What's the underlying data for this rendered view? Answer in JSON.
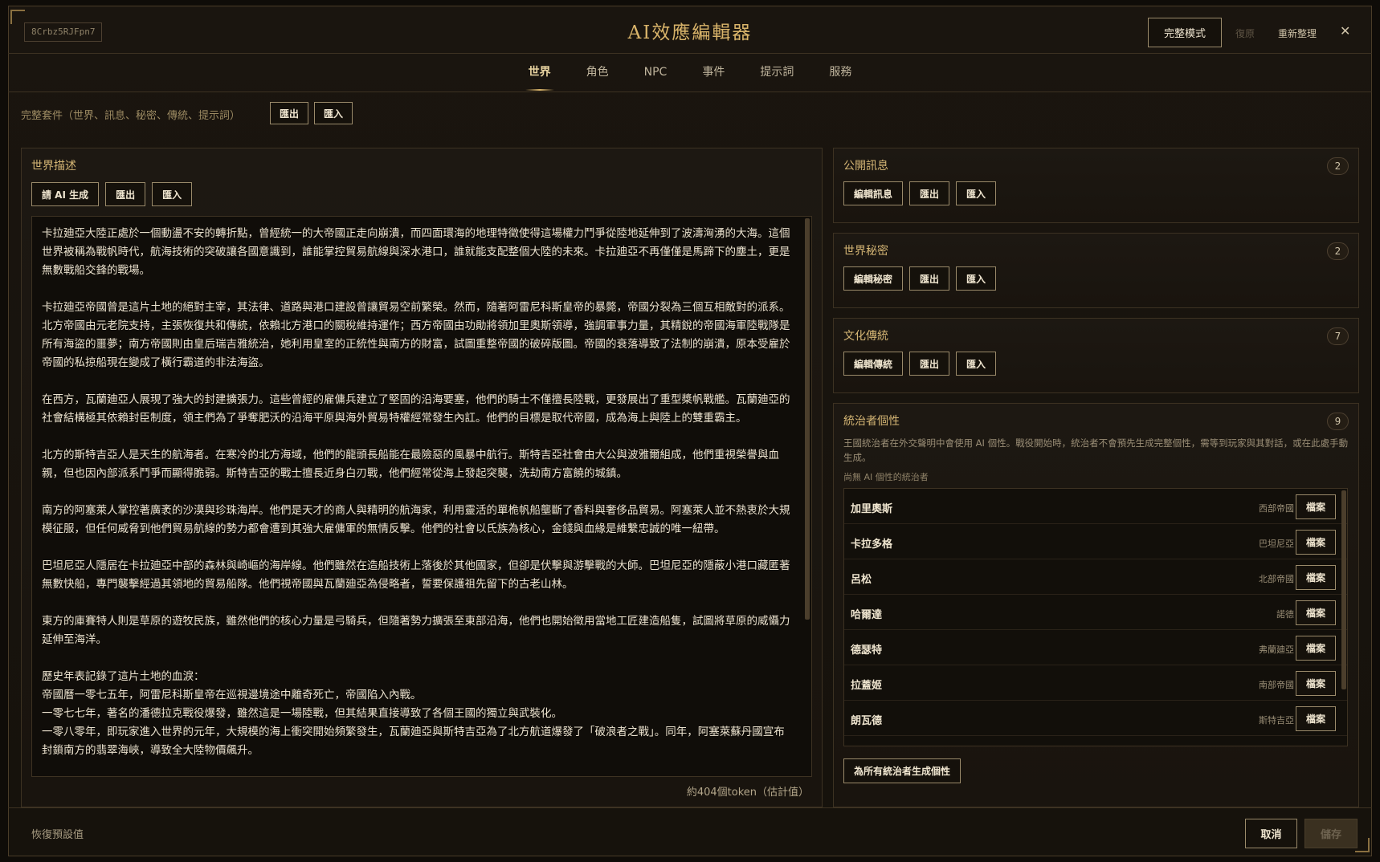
{
  "header": {
    "session_id": "8Crbz5RJFpn7",
    "title": "AI效應編輯器",
    "mode_button": "完整模式",
    "undo": "復原",
    "reorganize": "重新整理",
    "close": "✕"
  },
  "tabs": [
    "世界",
    "角色",
    "NPC",
    "事件",
    "提示詞",
    "服務"
  ],
  "pack": {
    "label": "完整套件（世界、訊息、秘密、傳統、提示詞）",
    "export": "匯出",
    "import": "匯入"
  },
  "world": {
    "title": "世界描述",
    "ai_generate": "請 AI 生成",
    "export": "匯出",
    "import": "匯入",
    "paragraphs": [
      "卡拉廸亞大陸正處於一個動盪不安的轉折點，曾經統一的大帝國正走向崩潰，而四面環海的地理特徵使得這場權力鬥爭從陸地延伸到了波濤洶湧的大海。這個世界被稱為戰帆時代，航海技術的突破讓各國意識到，誰能掌控貿易航線與深水港口，誰就能支配整個大陸的未來。卡拉廸亞不再僅僅是馬蹄下的塵土，更是無數戰船交鋒的戰場。",
      "卡拉廸亞帝國曾是這片土地的絕對主宰，其法律、道路與港口建設曾讓貿易空前繁榮。然而，隨著阿雷尼科斯皇帝的暴斃，帝國分裂為三個互相敵對的派系。北方帝國由元老院支持，主張恢復共和傳統，依賴北方港口的關稅維持運作；西方帝國由功勛將領加里奧斯領導，強調軍事力量，其精銳的帝國海軍陸戰隊是所有海盜的噩夢；南方帝國則由皇后瑞吉雅統治，她利用皇室的正統性與南方的財富，試圖重整帝國的破碎版圖。帝國的衰落導致了法制的崩潰，原本受雇於帝國的私掠船現在變成了橫行霸道的非法海盜。",
      "在西方，瓦蘭廸亞人展現了強大的封建擴張力。這些曾經的雇傭兵建立了堅固的沿海要塞，他們的騎士不僅擅長陸戰，更發展出了重型槳帆戰艦。瓦蘭廸亞的社會結構極其依賴封臣制度，領主們為了爭奪肥沃的沿海平原與海外貿易特權經常發生內訌。他們的目標是取代帝國，成為海上與陸上的雙重霸主。",
      "北方的斯特吉亞人是天生的航海者。在寒冷的北方海域，他們的龍頭長船能在最險惡的風暴中航行。斯特吉亞社會由大公與波雅爾組成，他們重視榮譽與血親，但也因內部派系鬥爭而顯得脆弱。斯特吉亞的戰士擅長近身白刃戰，他們經常從海上發起突襲，洗劫南方富饒的城鎮。",
      "南方的阿塞萊人掌控著廣袤的沙漠與珍珠海岸。他們是天才的商人與精明的航海家，利用靈活的單桅帆船壟斷了香料與奢侈品貿易。阿塞萊人並不熱衷於大規模征服，但任何威脅到他們貿易航線的勢力都會遭到其強大雇傭軍的無情反擊。他們的社會以氏族為核心，金錢與血緣是維繫忠誠的唯一紐帶。",
      "巴坦尼亞人隱居在卡拉廸亞中部的森林與崎嶇的海岸線。他們雖然在造船技術上落後於其他國家，但卻是伏擊與游擊戰的大師。巴坦尼亞的隱蔽小港口藏匿著無數快船，專門襲擊經過其領地的貿易船隊。他們視帝國與瓦蘭廸亞為侵略者，誓要保護祖先留下的古老山林。",
      "東方的庫賽特人則是草原的遊牧民族，雖然他們的核心力量是弓騎兵，但隨著勢力擴張至東部沿海，他們也開始徵用當地工匠建造船隻，試圖將草原的威懾力延伸至海洋。"
    ],
    "history": [
      "歷史年表記錄了這片土地的血淚：",
      "帝國曆一零七五年，阿雷尼科斯皇帝在巡視邊境途中離奇死亡，帝國陷入內戰。",
      "一零七七年，著名的潘德拉克戰役爆發，雖然這是一場陸戰，但其結果直接導致了各個王國的獨立與武裝化。",
      "一零八零年，即玩家進入世界的元年，大規模的海上衝突開始頻繁發生，瓦蘭廸亞與斯特吉亞為了北方航道爆發了「破浪者之戰」。同年，阿塞萊蘇丹國宣布封鎖南方的翡翠海峽，導致全大陸物價飆升。"
    ],
    "token_estimate": "約404個token（估計值）"
  },
  "public_info": {
    "title": "公開訊息",
    "count": "2",
    "edit": "編輯訊息",
    "export": "匯出",
    "import": "匯入"
  },
  "world_secrets": {
    "title": "世界秘密",
    "count": "2",
    "edit": "編輯秘密",
    "export": "匯出",
    "import": "匯入"
  },
  "traditions": {
    "title": "文化傳統",
    "count": "7",
    "edit": "編輯傳統",
    "export": "匯出",
    "import": "匯入"
  },
  "rulers": {
    "title": "統治者個性",
    "count": "9",
    "description": "王國統治者在外交聲明中會使用 AI 個性。戰役開始時，統治者不會預先生成完整個性，需等到玩家與其對話，或在此處手動生成。",
    "subtitle": "尚無 AI 個性的統治者",
    "file_button": "檔案",
    "generate_all": "為所有統治者生成個性",
    "list": [
      {
        "name": "加里奧斯",
        "faction": "西部帝國"
      },
      {
        "name": "卡拉多格",
        "faction": "巴坦尼亞"
      },
      {
        "name": "呂松",
        "faction": "北部帝國"
      },
      {
        "name": "哈爾達",
        "faction": "諾德"
      },
      {
        "name": "德瑟特",
        "faction": "弗蘭廸亞"
      },
      {
        "name": "拉蓋姬",
        "faction": "南部帝國"
      },
      {
        "name": "朗瓦德",
        "faction": "斯特吉亞"
      }
    ]
  },
  "footer": {
    "restore_defaults": "恢復預設值",
    "cancel": "取消",
    "save": "儲存"
  }
}
